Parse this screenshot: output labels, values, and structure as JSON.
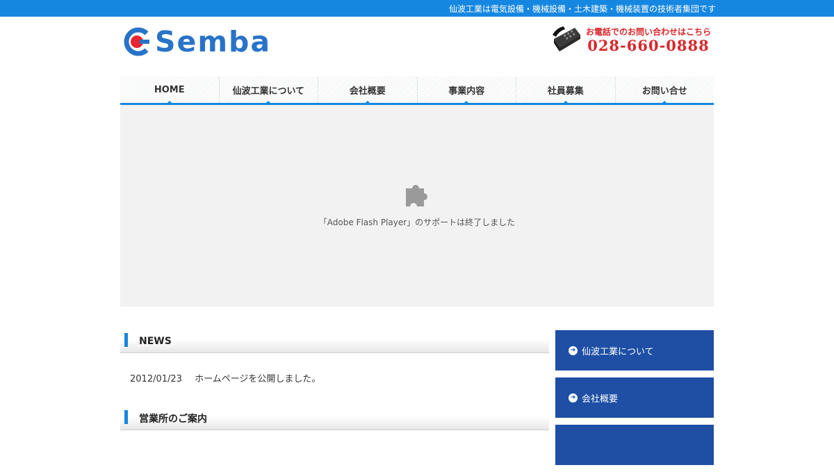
{
  "topbar": {
    "tagline": "仙波工業は電気設備・機械設備・土木建築・機械装置の技術者集団です"
  },
  "header": {
    "logo_text": "Semba",
    "phone_caption": "お電話でのお問い合わせはこちら",
    "phone_number": "028-660-0888"
  },
  "nav": {
    "items": [
      {
        "label": "HOME"
      },
      {
        "label": "仙波工業について"
      },
      {
        "label": "会社概要"
      },
      {
        "label": "事業内容"
      },
      {
        "label": "社員募集"
      },
      {
        "label": "お問い合せ"
      }
    ]
  },
  "flash": {
    "message": "「Adobe Flash Player」のサポートは終了しました"
  },
  "news": {
    "heading": "NEWS",
    "items": [
      {
        "date": "2012/01/23",
        "text": "ホームページを公開しました。"
      }
    ]
  },
  "offices": {
    "heading": "営業所のご案内"
  },
  "sidebar": {
    "items": [
      {
        "label": "仙波工業について"
      },
      {
        "label": "会社概要"
      },
      {
        "label": ""
      }
    ]
  },
  "colors": {
    "accent": "#1687e0",
    "sidebar": "#1e4fa5",
    "phone": "#d8282b",
    "logo": "#2873c8"
  }
}
